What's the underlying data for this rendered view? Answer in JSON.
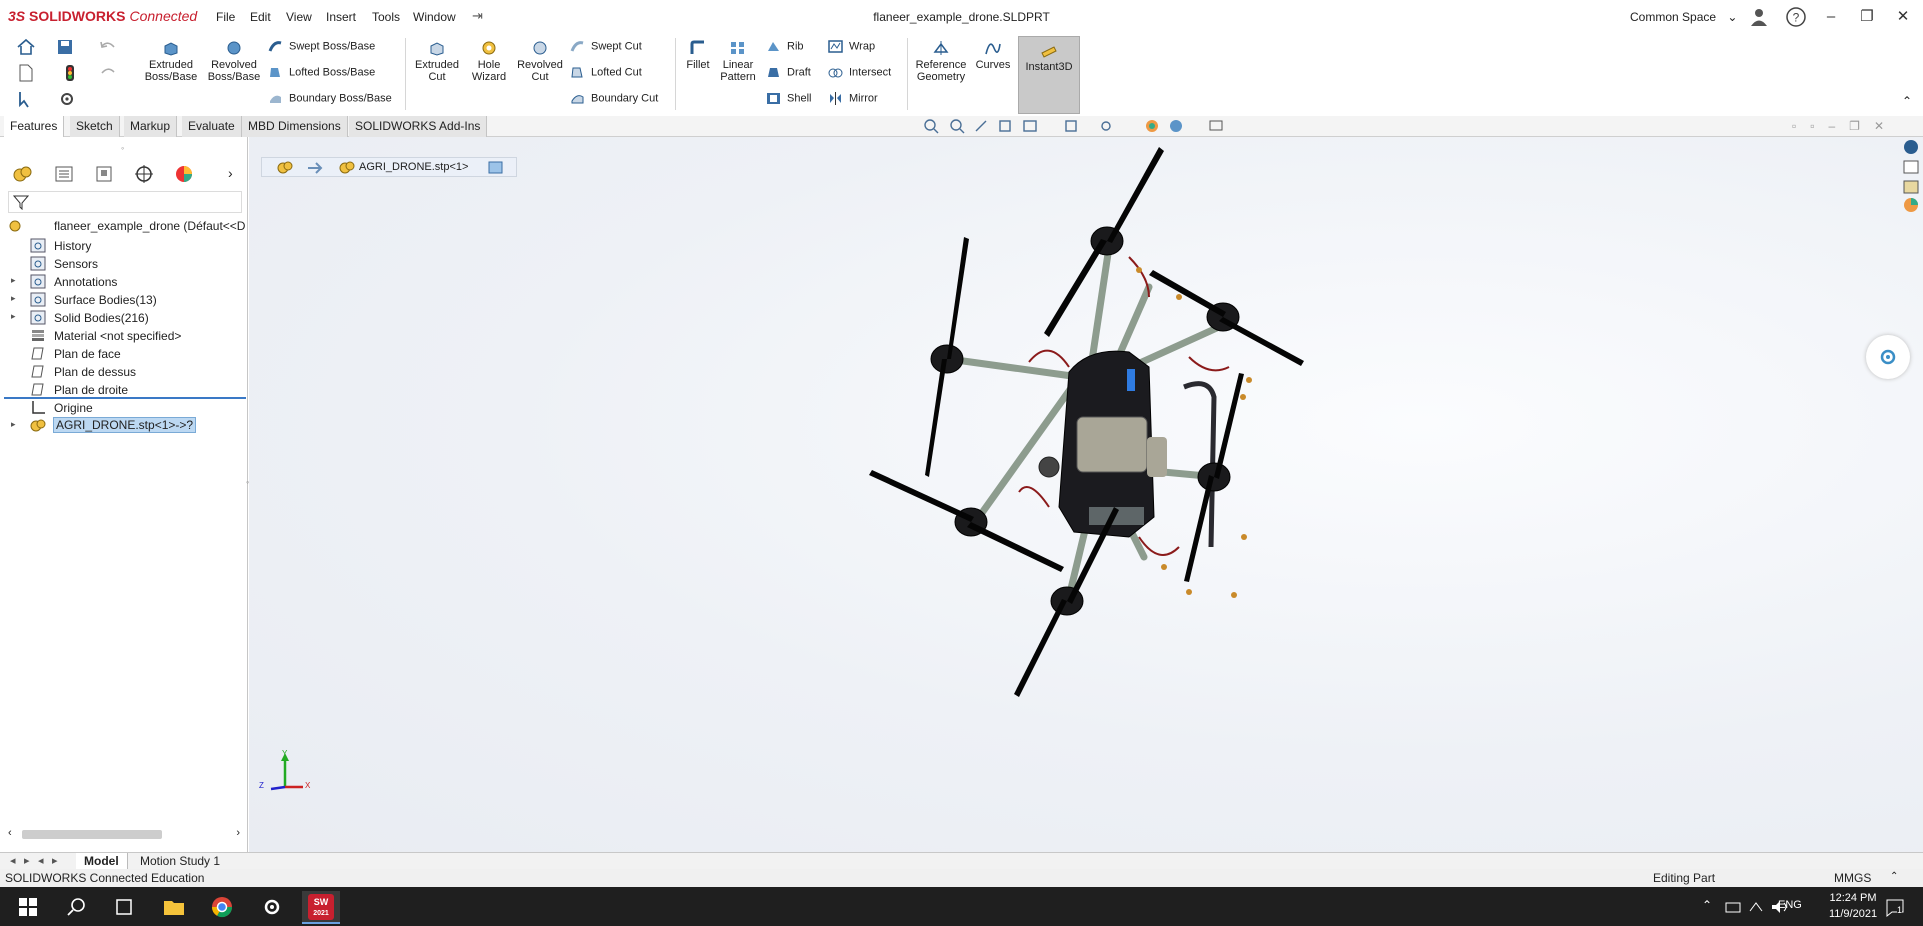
{
  "app": {
    "logo_brand": "SOLIDWORKS",
    "logo_suffix": "Connected",
    "menu": [
      "File",
      "Edit",
      "View",
      "Insert",
      "Tools",
      "Window"
    ],
    "document_title": "flaneer_example_drone.SLDPRT",
    "space_label": "Common Space"
  },
  "ribbon": {
    "extruded_boss": "Extruded\nBoss/Base",
    "revolved_boss": "Revolved\nBoss/Base",
    "swept_boss": "Swept Boss/Base",
    "lofted_boss": "Lofted Boss/Base",
    "boundary_boss": "Boundary Boss/Base",
    "extruded_cut": "Extruded\nCut",
    "hole_wizard": "Hole\nWizard",
    "revolved_cut": "Revolved\nCut",
    "swept_cut": "Swept Cut",
    "lofted_cut": "Lofted Cut",
    "boundary_cut": "Boundary Cut",
    "fillet": "Fillet",
    "linear_pattern": "Linear\nPattern",
    "rib": "Rib",
    "draft": "Draft",
    "shell": "Shell",
    "wrap": "Wrap",
    "intersect": "Intersect",
    "mirror": "Mirror",
    "reference_geometry": "Reference\nGeometry",
    "curves": "Curves",
    "instant3d": "Instant3D"
  },
  "tabs": [
    "Features",
    "Sketch",
    "Markup",
    "Evaluate",
    "MBD Dimensions",
    "SOLIDWORKS Add-Ins"
  ],
  "tree": {
    "root": "flaneer_example_drone  (Défaut<<D",
    "items": [
      {
        "label": "History",
        "expandable": false
      },
      {
        "label": "Sensors",
        "expandable": false
      },
      {
        "label": "Annotations",
        "expandable": true
      },
      {
        "label": "Surface Bodies(13)",
        "expandable": true
      },
      {
        "label": "Solid Bodies(216)",
        "expandable": true
      },
      {
        "label": "Material <not specified>",
        "expandable": false
      },
      {
        "label": "Plan de face",
        "expandable": false
      },
      {
        "label": "Plan de dessus",
        "expandable": false
      },
      {
        "label": "Plan de droite",
        "expandable": false
      },
      {
        "label": "Origine",
        "expandable": false
      },
      {
        "label": "AGRI_DRONE.stp<1>->?",
        "expandable": true
      }
    ]
  },
  "breadcrumb": "AGRI_DRONE.stp<1>",
  "axes": {
    "x": "X",
    "y": "Y",
    "z": "Z"
  },
  "bottom_tabs": [
    "Model",
    "Motion Study 1"
  ],
  "status": {
    "left": "SOLIDWORKS Connected Education",
    "mode": "Editing Part",
    "units": "MMGS"
  },
  "taskbar": {
    "lang": "ENG",
    "time": "12:24 PM",
    "date": "11/9/2021",
    "notif": "1",
    "sw_badge": "2021"
  },
  "colors": {
    "brand_red": "#c8202f",
    "selection": "#bcd8f2",
    "taskbar": "#1f1f1f"
  }
}
